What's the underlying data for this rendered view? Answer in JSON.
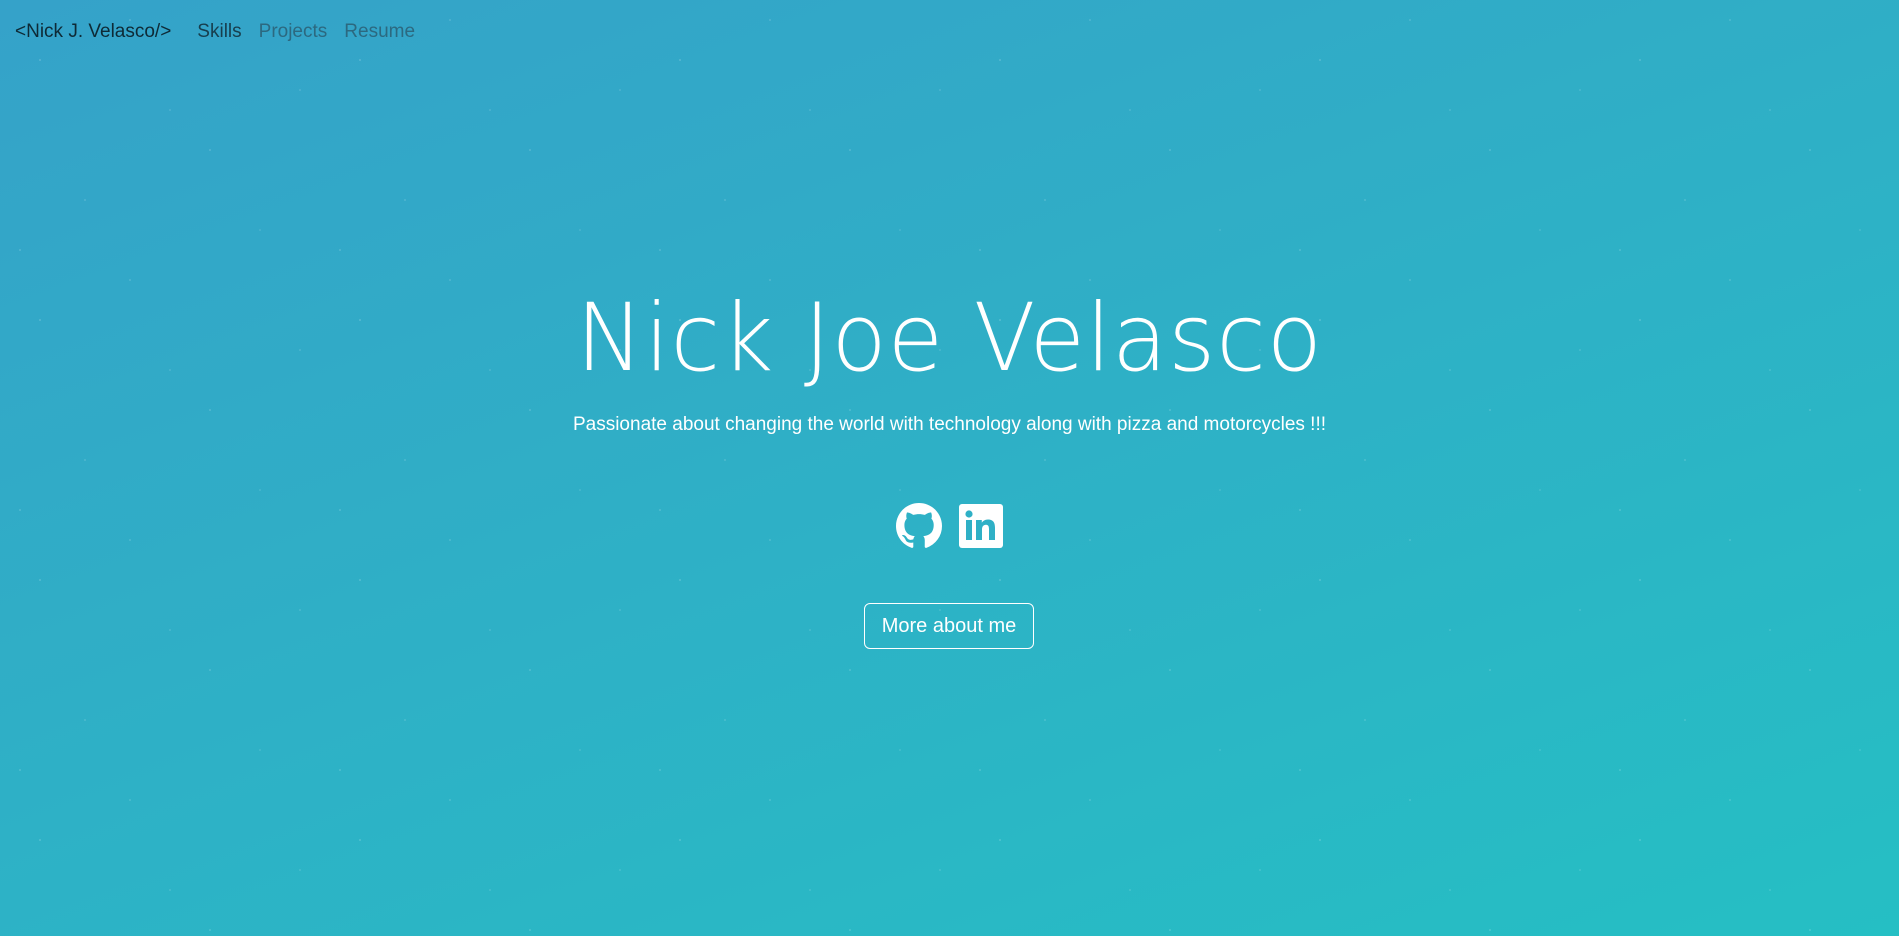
{
  "nav": {
    "brand": "<Nick J. Velasco/>",
    "links": [
      {
        "label": "Skills"
      },
      {
        "label": "Projects"
      },
      {
        "label": "Resume"
      }
    ]
  },
  "hero": {
    "title": "Nick Joe Velasco",
    "subtitle": "Passionate about changing the world with technology along with pizza and motorcycles !!!",
    "socials": [
      {
        "icon": "github-icon"
      },
      {
        "icon": "linkedin-icon"
      }
    ],
    "cta_label": "More about me"
  },
  "colors": {
    "background_start": "#35a2c9",
    "background_end": "#25bfc4",
    "text": "#ffffff",
    "brand_text": "#0e2a36"
  }
}
